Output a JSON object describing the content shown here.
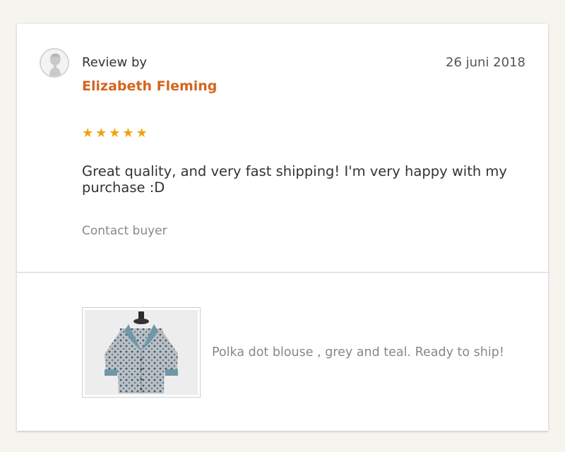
{
  "review": {
    "label": "Review by",
    "reviewer": "Elizabeth Fleming",
    "date": "26 juni 2018",
    "rating": 5,
    "text": "Great quality, and very fast shipping! I'm very happy with my purchase :D",
    "contact_label": "Contact buyer"
  },
  "stars": [
    "★",
    "★",
    "★",
    "★",
    "★"
  ],
  "product": {
    "title": "Polka dot blouse , grey and teal. Ready to ship!"
  },
  "colors": {
    "reviewer_name": "#d5641c",
    "star": "#f1a10d",
    "blouse_body": "#a9b2b8",
    "blouse_collar": "#6f97a8"
  }
}
